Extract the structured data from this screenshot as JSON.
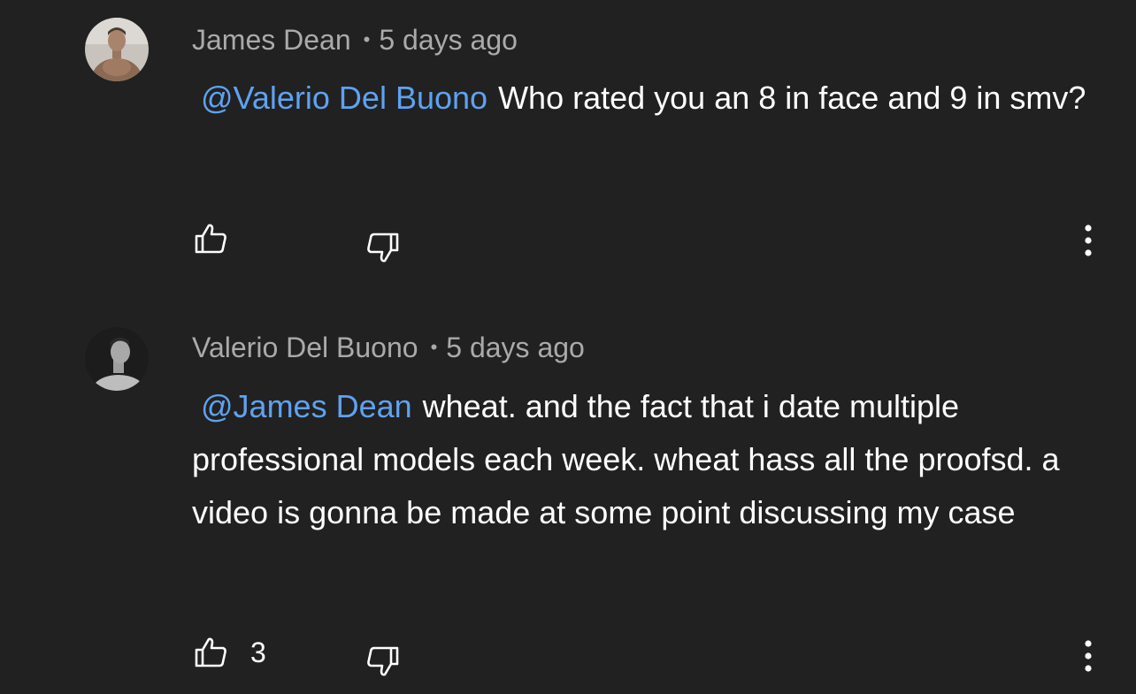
{
  "comments": [
    {
      "author": "James Dean",
      "separator": "•",
      "time": "5 days ago",
      "mention": "@Valerio Del Buono",
      "body": "Who rated you an 8 in face and 9 in smv?",
      "like_count": "",
      "avatar_icon": "user-avatar-shirtless",
      "like_icon": "thumbs-up-icon",
      "dislike_icon": "thumbs-down-icon",
      "menu_icon": "more-vertical-icon"
    },
    {
      "author": "Valerio Del Buono",
      "separator": "•",
      "time": "5 days ago",
      "mention": "@James Dean",
      "body": "wheat. and the fact that i date multiple professional models each week. wheat hass all the proofsd. a video is gonna be made at some point discussing my case",
      "like_count": "3",
      "avatar_icon": "user-avatar-portrait",
      "like_icon": "thumbs-up-icon",
      "dislike_icon": "thumbs-down-icon",
      "menu_icon": "more-vertical-icon"
    }
  ],
  "colors": {
    "background": "#212121",
    "meta_text": "#aaaaaa",
    "mention": "#5fa2f0",
    "body_text": "#ffffff"
  }
}
